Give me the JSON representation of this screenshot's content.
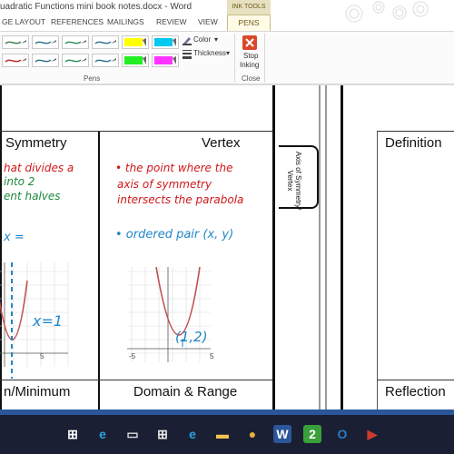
{
  "window": {
    "title": "uadratic Functions mini book notes.docx - Word"
  },
  "ink_tools_label": "INK TOOLS",
  "tabs": [
    "GE LAYOUT",
    "REFERENCES",
    "MAILINGS",
    "REVIEW",
    "VIEW",
    "PENS"
  ],
  "ribbon": {
    "color_label": "Color",
    "thickness_label": "Thickness",
    "pens_group_label": "Pens",
    "stop_inking_line1": "Stop",
    "stop_inking_line2": "Inking",
    "close_group_label": "Close"
  },
  "pens": [
    {
      "color": "#3b7a4a",
      "highlight": false
    },
    {
      "color": "#2b6f8a",
      "highlight": false
    },
    {
      "color": "#2d8c5a",
      "highlight": false
    },
    {
      "color": "#2b6f8a",
      "highlight": false
    },
    {
      "color": "#ffff00",
      "highlight": true
    },
    {
      "color": "#00c8f0",
      "highlight": true
    },
    {
      "color": "#c02020",
      "highlight": false
    },
    {
      "color": "#2b6f8a",
      "highlight": false
    },
    {
      "color": "#2d8c5a",
      "highlight": false
    },
    {
      "color": "#2b6f8a",
      "highlight": false
    },
    {
      "color": "#22ee22",
      "highlight": true
    },
    {
      "color": "#ff33ff",
      "highlight": true
    }
  ],
  "document": {
    "panel1_heading": "Symmetry",
    "panel1_ink_line1": "hat divides a",
    "panel1_ink_line2": "into 2",
    "panel1_ink_line3": "ent halves",
    "panel1_formula": "x =",
    "panel1_graph_label": "x=1",
    "panel1_tick": "5",
    "panel1_bottom_heading": "n/Minimum",
    "panel2_heading": "Vertex",
    "panel2_ink_line1": "• the point where the",
    "panel2_ink_line2": "axis of symmetry",
    "panel2_ink_line3": "intersects the parabola",
    "panel2_ink_line4": "• ordered pair (x, y)",
    "panel2_graph_label": "(1,2)",
    "panel2_tick_left": "-5",
    "panel2_tick_right": "5",
    "panel2_bottom_heading": "Domain & Range",
    "tab_label": "Axis of Symmetry/ Vertex",
    "panel3_heading": "Definition",
    "panel3_bottom_heading": "Reflection"
  },
  "colors": {
    "word_blue": "#2b579a",
    "ink_red": "#d0181a",
    "ink_green": "#1c8a3a",
    "ink_blue": "#1f86c9",
    "parabola": "#c0504d"
  },
  "taskbar_icons": [
    "windows-icon",
    "ie-icon",
    "file-explorer-icon",
    "store-icon",
    "edge-icon",
    "folder-icon",
    "chrome-icon",
    "word-icon",
    "app-green-icon",
    "outlook-icon",
    "media-icon"
  ]
}
